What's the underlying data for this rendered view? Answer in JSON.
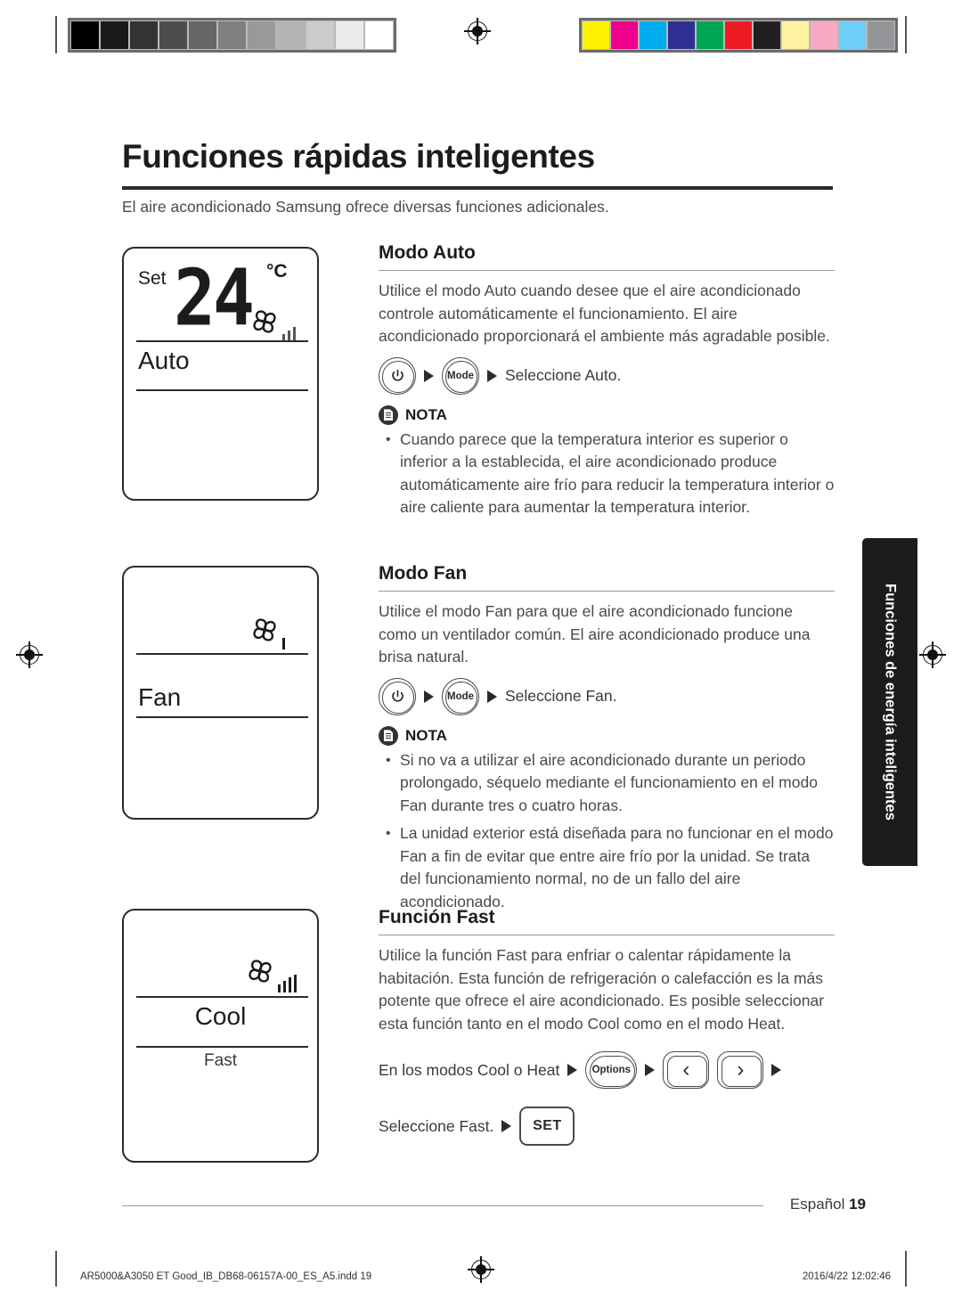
{
  "print_marks": {
    "grayscale_swatches": [
      "#000000",
      "#1a1a1a",
      "#333333",
      "#4d4d4d",
      "#666666",
      "#808080",
      "#999999",
      "#b3b3b3",
      "#cccccc",
      "#ebebeb",
      "#ffffff"
    ],
    "color_swatches": [
      "#fff200",
      "#ec008c",
      "#00aeef",
      "#2e3192",
      "#00a651",
      "#ed1c24",
      "#231f20",
      "#fdf2a0",
      "#f7a8c4",
      "#6dcff6",
      "#939598"
    ],
    "registration_icon": "registration-target-icon"
  },
  "page": {
    "title": "Funciones rápidas inteligentes",
    "intro": "El aire acondicionado Samsung ofrece diversas funciones adicionales."
  },
  "lcd_panels": [
    {
      "name": "auto",
      "set_label": "Set",
      "temperature": "24",
      "unit": "°C",
      "mode_word": "Auto",
      "fan_icon": "fan-pinwheel-icon",
      "fan_bars": 3
    },
    {
      "name": "fan",
      "mode_word": "Fan",
      "fan_icon": "fan-pinwheel-icon",
      "fan_bars": 1
    },
    {
      "name": "cool",
      "mode_word": "Cool",
      "sub_word": "Fast",
      "fan_icon": "fan-pinwheel-icon",
      "fan_bars": 4
    }
  ],
  "sections": [
    {
      "heading": "Modo Auto",
      "body": "Utilice el modo Auto cuando desee que el aire acondicionado controle automáticamente el funcionamiento. El aire acondicionado proporcionará el ambiente más agradable posible.",
      "sequence": {
        "power_icon": "power-button-icon",
        "mode_label": "Mode",
        "action": "Seleccione Auto."
      },
      "note": {
        "label": "NOTA",
        "icon": "note-document-icon",
        "bullets": [
          "Cuando parece que la temperatura interior es superior o inferior a la establecida, el aire acondicionado produce automáticamente aire frío para reducir la temperatura interior o aire caliente para aumentar la temperatura interior."
        ]
      }
    },
    {
      "heading": "Modo Fan",
      "body": "Utilice el modo Fan para que el aire acondicionado funcione como un ventilador común. El aire acondicionado produce una brisa natural.",
      "sequence": {
        "power_icon": "power-button-icon",
        "mode_label": "Mode",
        "action": "Seleccione Fan."
      },
      "note": {
        "label": "NOTA",
        "icon": "note-document-icon",
        "bullets": [
          "Si no va a utilizar el aire acondicionado durante un periodo prolongado, séquelo mediante el funcionamiento en el modo Fan durante tres o cuatro horas.",
          "La unidad exterior está diseñada para no funcionar en el modo Fan a fin de evitar que entre aire frío por la unidad. Se trata del funcionamiento normal, no de un fallo del aire acondicionado."
        ]
      }
    },
    {
      "heading": "Función Fast",
      "body": "Utilice la función Fast para enfriar o calentar rápidamente la habitación. Esta función de refrigeración o calefacción es la más potente que ofrece el aire acondicionado. Es posible seleccionar esta función tanto en el modo Cool como en el modo Heat.",
      "fast_sequence": {
        "prefix": "En los modos Cool o Heat",
        "options_label": "Options",
        "prev_icon": "chevron-left-icon",
        "next_icon": "chevron-right-icon",
        "second_line": "Seleccione Fast.",
        "set_label": "SET"
      }
    }
  ],
  "side_tab": {
    "label": "Funciones de energía inteligentes"
  },
  "footer": {
    "language": "Español",
    "page_number": "19"
  },
  "imprint": {
    "file": "AR5000&A3050 ET Good_IB_DB68-06157A-00_ES_A5.indd   19",
    "timestamp": "2016/4/22   12:02:46"
  }
}
